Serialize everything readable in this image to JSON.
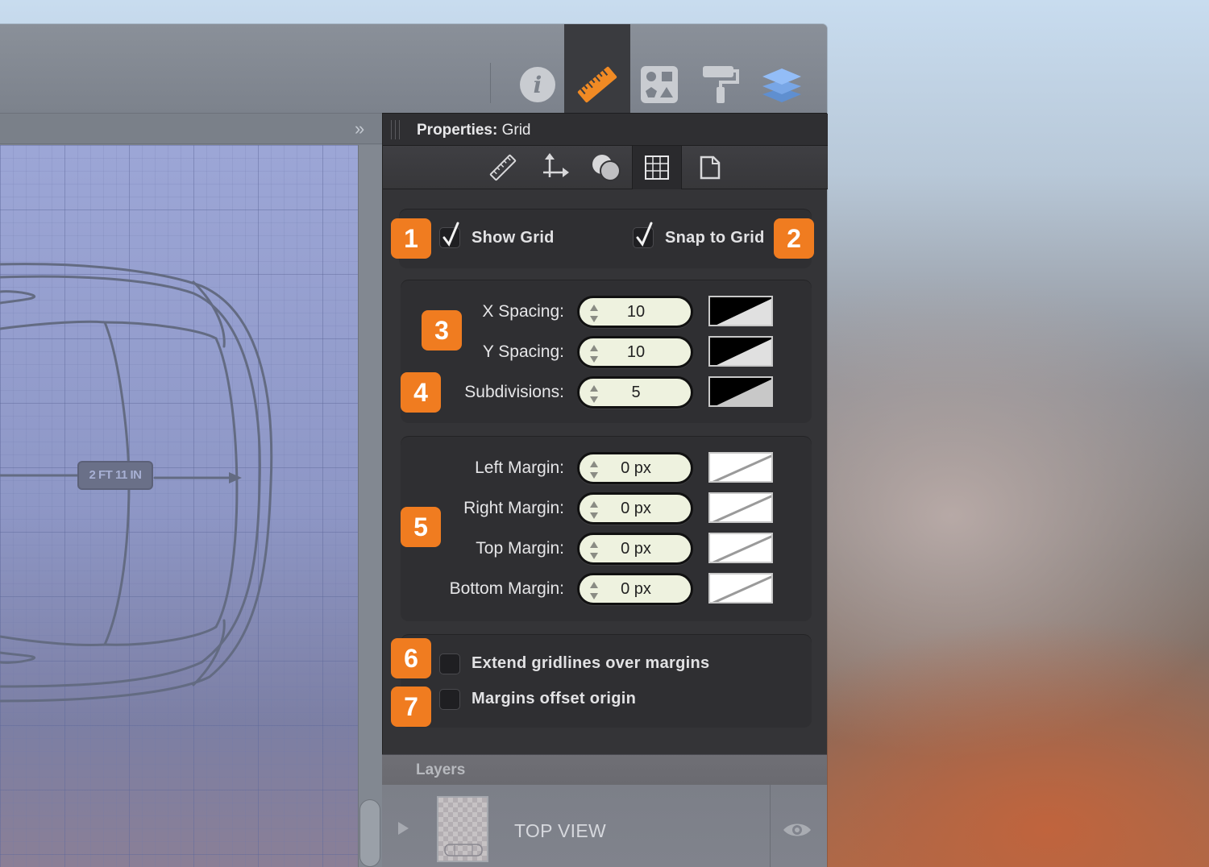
{
  "panel": {
    "title_bold": "Properties:",
    "title_rest": "Grid"
  },
  "toolbar": {
    "tabs": [
      {
        "icon": "info-icon"
      },
      {
        "icon": "ruler-icon",
        "active": true
      },
      {
        "icon": "shapes-icon"
      },
      {
        "icon": "paint-roller-icon"
      },
      {
        "icon": "layers-icon"
      }
    ]
  },
  "subtabs": [
    "ruler-icon",
    "move-anchor-icon",
    "circles-icon",
    "grid-icon",
    "page-icon"
  ],
  "canvas": {
    "dimension_label": "2 FT 11 IN",
    "collapse": "»"
  },
  "grid": {
    "show_grid": {
      "label": "Show Grid",
      "checked": true,
      "badge": "1"
    },
    "snap_to_grid": {
      "label": "Snap to Grid",
      "checked": true,
      "badge": "2"
    },
    "spacing_badge": "3",
    "subdivisions_badge": "4",
    "margins_badge": "5",
    "rows": [
      {
        "label": "X Spacing:",
        "value": "10"
      },
      {
        "label": "Y Spacing:",
        "value": "10"
      },
      {
        "label": "Subdivisions:",
        "value": "5"
      }
    ],
    "margins": [
      {
        "label": "Left Margin:",
        "value": "0 px"
      },
      {
        "label": "Right Margin:",
        "value": "0 px"
      },
      {
        "label": "Top Margin:",
        "value": "0 px"
      },
      {
        "label": "Bottom Margin:",
        "value": "0 px"
      }
    ],
    "extend": {
      "label": "Extend gridlines over margins",
      "checked": false,
      "badge": "6"
    },
    "offset": {
      "label": "Margins offset origin",
      "checked": false,
      "badge": "7"
    }
  },
  "layers": {
    "title": "Layers",
    "items": [
      {
        "name": "TOP VIEW"
      }
    ]
  },
  "colors": {
    "badge": "#f07c20",
    "panel_bg": "#343437",
    "stepper_bg": "#eef2df"
  }
}
